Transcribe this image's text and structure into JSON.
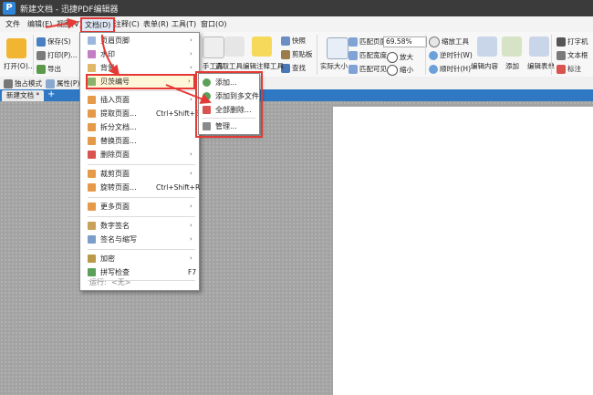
{
  "window": {
    "title": "新建文档 - 迅捷PDF编辑器"
  },
  "menubar": {
    "items": [
      "文件",
      "编辑(E)",
      "视图(V)",
      "文档(D)",
      "注释(C)",
      "表单(R)",
      "工具(T)",
      "窗口(O)"
    ]
  },
  "ribbon": {
    "open": "打开(O)...",
    "save": "保存(S)",
    "print": "打印(P)...",
    "export": "导出",
    "snapshot": "快照",
    "clipboard": "剪贴板",
    "find": "查找",
    "actual_size": "实际大小",
    "fit_page": "匹配页面",
    "fit_width": "匹配宽度",
    "fit_visible": "匹配可见",
    "zoom_value": "69.58%",
    "zoom_in": "放大",
    "zoom_out": "缩小",
    "zoom_tool": "缩放工具",
    "rotate_ccw": "逆时针(W)",
    "rotate_cw": "顺时针(H)",
    "select_tool": "选取工具",
    "edit_annot": "编辑注释工具",
    "hand_tool": "手工具",
    "edit_content": "编辑内容",
    "add": "添加",
    "edit_form": "编辑表单",
    "typewriter": "打字机",
    "textbox": "文本框",
    "mark": "标注"
  },
  "statusrow": {
    "single_mode": "独占模式",
    "properties": "属性(P)..."
  },
  "tabs": {
    "doc_tab": "新建文档 *",
    "plus": "+"
  },
  "doc_menu": {
    "items": [
      {
        "label": "页眉页脚",
        "arrow": "›"
      },
      {
        "label": "水印",
        "arrow": "›"
      },
      {
        "label": "背景",
        "arrow": "›"
      },
      {
        "label": "贝茨编号",
        "arrow": "›"
      },
      {
        "label": "插入页面",
        "arrow": "›"
      },
      {
        "label": "提取页面...",
        "shortcut": "Ctrl+Shift+E"
      },
      {
        "label": "拆分文档..."
      },
      {
        "label": "替换页面..."
      },
      {
        "label": "删除页面",
        "arrow": "›"
      },
      {
        "label": "裁剪页面",
        "arrow": "›"
      },
      {
        "label": "旋转页面...",
        "shortcut": "Ctrl+Shift+R"
      },
      {
        "label": "更多页面",
        "arrow": "›"
      },
      {
        "label": "数字签名",
        "arrow": "›"
      },
      {
        "label": "签名与缩写",
        "arrow": "›"
      },
      {
        "label": "加密",
        "arrow": "›"
      },
      {
        "label": "拼写检查",
        "shortcut": "F7"
      }
    ],
    "run_label": "运行:",
    "run_value": "<无>"
  },
  "bates_menu": {
    "items": [
      {
        "label": "添加..."
      },
      {
        "label": "添加到多文件"
      },
      {
        "label": "全部删除..."
      },
      {
        "label": "管理..."
      }
    ]
  },
  "colors": {
    "accent_red": "#e53935",
    "title_bg": "#3b3b3b",
    "tab_blue": "#2f78c4",
    "highlight": "#fff7d8"
  }
}
